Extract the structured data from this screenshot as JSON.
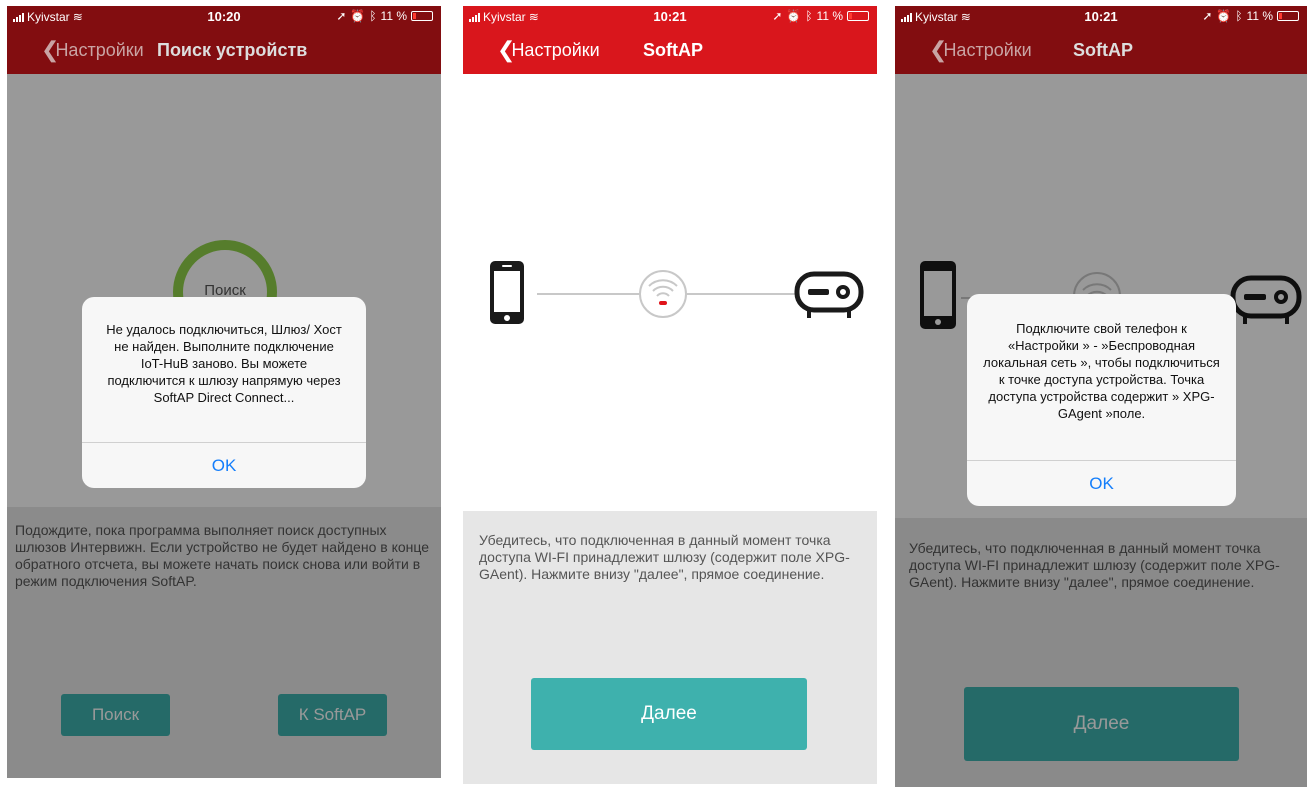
{
  "colors": {
    "header_red_dark": "#8b0a10",
    "header_red": "#d9161c",
    "teal": "#3eb1ad",
    "ios_blue": "#147efb"
  },
  "screens": [
    {
      "status": {
        "carrier": "Kyivstar",
        "time": "10:20",
        "battery": "11 %"
      },
      "nav": {
        "back_label": "Настройки",
        "title": "Поиск устройств"
      },
      "search_ring_label": "Поиск",
      "alert": {
        "message": "Не удалось подключиться, Шлюз/ Хост не найден. Выполните подключение IoT-HuB  заново. Вы можете подключится к шлюзу напрямую через SoftAP Direct Connect...",
        "ok_label": "OK"
      },
      "info_text": "Подождите, пока программа выполняет поиск доступных шлюзов Интервижн. Если устройство не будет найдено в конце обратного отсчета, вы можете начать поиск снова или войти в режим подключения SoftAP.",
      "buttons": {
        "search_label": "Поиск",
        "softap_label": "К SoftAP"
      }
    },
    {
      "status": {
        "carrier": "Kyivstar",
        "time": "10:21",
        "battery": "11 %"
      },
      "nav": {
        "back_label": "Настройки",
        "title": "SoftAP"
      },
      "icons": [
        "phone-icon",
        "wifi-icon",
        "gateway-icon"
      ],
      "info_text": "Убедитесь, что подключенная в данный момент точка доступа WI-FI принадлежит шлюзу (содержит поле XPG-GAent). Нажмите внизу \"далее\", прямое соединение.",
      "next_label": "Далее"
    },
    {
      "status": {
        "carrier": "Kyivstar",
        "time": "10:21",
        "battery": "11 %"
      },
      "nav": {
        "back_label": "Настройки",
        "title": "SoftAP"
      },
      "alert": {
        "message": "Подключите свой телефон к «Настройки » - »Беспроводная локальная сеть », чтобы подключиться к точке доступа устройства. Точка доступа устройства содержит » XPG-GAgent »поле.",
        "ok_label": "OK"
      },
      "info_text": "Убедитесь, что подключенная в данный момент точка доступа WI-FI принадлежит шлюзу (содержит поле XPG-GAent). Нажмите внизу \"далее\", прямое соединение.",
      "next_label": "Далее"
    }
  ]
}
